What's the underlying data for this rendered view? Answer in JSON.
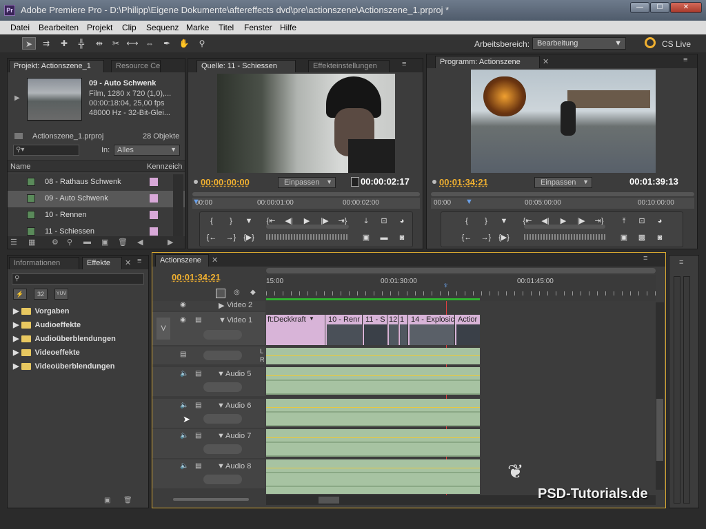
{
  "window": {
    "title": "Adobe Premiere Pro - D:\\Philipp\\Eigene Dokumente\\aftereffects dvd\\pre\\actionszene\\Actionszene_1.prproj *",
    "app_icon": "Pr",
    "min": "—",
    "max": "☐",
    "close": "✕"
  },
  "menu": [
    "Datei",
    "Bearbeiten",
    "Projekt",
    "Clip",
    "Sequenz",
    "Marke",
    "Titel",
    "Fenster",
    "Hilfe"
  ],
  "toolbar": {
    "workspace_label": "Arbeitsbereich:",
    "workspace_value": "Bearbeitung",
    "cs_live": "CS Live"
  },
  "project_panel": {
    "tabs": [
      "Projekt: Actionszene_1",
      "Resource Cer"
    ],
    "clip_name": "09 - Auto Schwenk",
    "clip_info1": "Film, 1280 x 720 (1,0),...",
    "clip_info2": "00:00:18:04, 25,00 fps",
    "clip_info3": "48000 Hz - 32-Bit-Glei...",
    "project_file": "Actionszene_1.prproj",
    "object_count": "28 Objekte",
    "in_label": "In:",
    "in_value": "Alles",
    "col_name": "Name",
    "col_label": "Kennzeich",
    "items": [
      "08 - Rathaus Schwenk",
      "09 - Auto Schwenk",
      "10 - Rennen",
      "11 - Schiessen"
    ]
  },
  "source_panel": {
    "tabs": [
      "Quelle: 11 - Schiessen",
      "Effekteinstellungen"
    ],
    "timecode_in": "00:00:00:00",
    "fit": "Einpassen",
    "duration": "00:00:02:17",
    "ruler": [
      "00:00",
      "00:00:01:00",
      "00:00:02:00"
    ]
  },
  "program_panel": {
    "tabs": [
      "Programm: Actionszene"
    ],
    "timecode_in": "00:01:34:21",
    "fit": "Einpassen",
    "duration": "00:01:39:13",
    "ruler": [
      "00:00",
      "00:05:00:00",
      "00:10:00:00"
    ]
  },
  "effects_panel": {
    "tabs": [
      "Informationen",
      "Effekte"
    ],
    "buttons": [
      "32",
      "YUV"
    ],
    "folders": [
      "Vorgaben",
      "Audioeffekte",
      "Audioüberblendungen",
      "Videoeffekte",
      "Videoüberblendungen"
    ]
  },
  "timeline": {
    "tab": "Actionszene",
    "timecode": "00:01:34:21",
    "ruler": [
      "15:00",
      "00:01:30:00",
      "00:01:45:00"
    ],
    "tracks": [
      "Video 2",
      "Video 1",
      "Audio 5",
      "Audio 6",
      "Audio 7",
      "Audio 8"
    ],
    "target_v": "V",
    "video_clips": [
      "ft:Deckkraft",
      "10 - Renr",
      "11 - S",
      "12",
      "1",
      "14 - Explosic",
      "Actior"
    ],
    "lr": [
      "L",
      "R"
    ]
  },
  "watermark": "PSD-Tutorials.de",
  "colors": {
    "accent_orange": "#f0b030",
    "audio_clip": "#a7c3a2",
    "video_clip": "#d8b4d8",
    "playhead": "#e04040"
  }
}
